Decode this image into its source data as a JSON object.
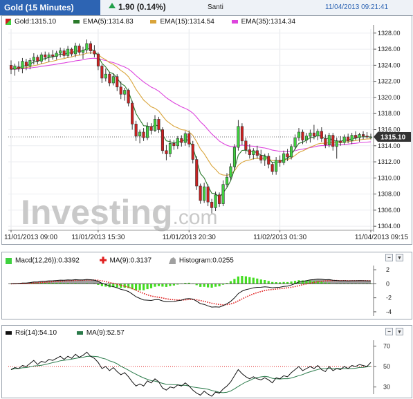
{
  "header": {
    "title": "Gold (15 Minutes)",
    "change": "1.90 (0.14%)",
    "user": "Santi",
    "datetime": "11/04/2013 09:21:41"
  },
  "price_panel": {
    "legend": {
      "instrument": "Gold:1315.10",
      "ema5": "EMA(5):1314.83",
      "ema15": "EMA(15):1314.54",
      "ema35": "EMA(35):1314.34"
    },
    "last_price_label": "1315.10",
    "watermark": "Investing.com"
  },
  "macd_panel": {
    "legend": {
      "macd": "Macd(12,26)):0.3392",
      "ma": "MA(9):0.3137",
      "hist": "Histogram:0.0255"
    }
  },
  "rsi_panel": {
    "legend": {
      "rsi": "Rsi(14):54.10",
      "ma": "MA(9):52.57"
    }
  },
  "colors": {
    "up": "#3fd23f",
    "down": "#cc2020",
    "ema5": "#2a7a2a",
    "ema15": "#d9a43a",
    "ema35": "#dd44dd",
    "brand": "#2d64b3",
    "macd_line": "#111111",
    "macd_signal": "#e02020",
    "macd_hist": "#44dd22",
    "hist_area": "#a0a0a0"
  },
  "chart_data": [
    {
      "type": "candlestick",
      "title": "Gold (15 Minutes)",
      "xlabel": "",
      "ylabel": "",
      "ylim": [
        1303.5,
        1328.5
      ],
      "yticks": [
        1304,
        1306,
        1308,
        1310,
        1312,
        1314,
        1316,
        1318,
        1320,
        1322,
        1324,
        1326,
        1328
      ],
      "x_tick_labels": [
        "11/01/2013 09:00",
        "11/01/2013 15:30",
        "11/01/2013 20:30",
        "11/02/2013 01:30",
        "11/04/2013 09:15"
      ],
      "x_tick_index": [
        0,
        23,
        47,
        71,
        95
      ],
      "last_price": 1315.1,
      "candles": [
        [
          1324.0,
          1324.6,
          1322.9,
          1323.5
        ],
        [
          1323.5,
          1324.2,
          1322.7,
          1323.9
        ],
        [
          1323.8,
          1324.5,
          1323.2,
          1323.6
        ],
        [
          1323.6,
          1324.9,
          1323.0,
          1324.5
        ],
        [
          1324.4,
          1324.8,
          1323.4,
          1323.9
        ],
        [
          1323.9,
          1324.9,
          1323.5,
          1324.6
        ],
        [
          1324.6,
          1325.5,
          1324.1,
          1325.0
        ],
        [
          1325.0,
          1325.3,
          1324.1,
          1324.5
        ],
        [
          1324.5,
          1325.6,
          1324.2,
          1325.3
        ],
        [
          1325.3,
          1325.7,
          1324.6,
          1325.0
        ],
        [
          1325.0,
          1325.6,
          1324.4,
          1325.3
        ],
        [
          1325.3,
          1325.9,
          1324.7,
          1325.1
        ],
        [
          1325.1,
          1325.8,
          1324.7,
          1325.5
        ],
        [
          1325.5,
          1326.2,
          1325.0,
          1325.8
        ],
        [
          1325.8,
          1326.1,
          1324.9,
          1325.2
        ],
        [
          1325.2,
          1326.4,
          1324.9,
          1326.0
        ],
        [
          1326.0,
          1326.2,
          1325.1,
          1325.4
        ],
        [
          1325.4,
          1326.8,
          1325.0,
          1326.4
        ],
        [
          1326.4,
          1326.7,
          1325.3,
          1325.6
        ],
        [
          1325.6,
          1326.3,
          1324.8,
          1325.9
        ],
        [
          1325.9,
          1327.2,
          1325.5,
          1326.7
        ],
        [
          1326.7,
          1327.0,
          1325.4,
          1325.8
        ],
        [
          1325.8,
          1326.5,
          1325.0,
          1325.4
        ],
        [
          1325.4,
          1325.6,
          1323.4,
          1323.9
        ],
        [
          1323.9,
          1324.1,
          1321.8,
          1322.4
        ],
        [
          1322.4,
          1323.6,
          1322.0,
          1322.9
        ],
        [
          1322.9,
          1323.2,
          1321.4,
          1321.8
        ],
        [
          1321.8,
          1323.0,
          1321.5,
          1322.6
        ],
        [
          1322.6,
          1322.9,
          1320.8,
          1321.3
        ],
        [
          1321.3,
          1322.0,
          1319.8,
          1320.4
        ],
        [
          1320.4,
          1321.2,
          1319.6,
          1320.9
        ],
        [
          1320.9,
          1321.1,
          1318.9,
          1319.3
        ],
        [
          1319.3,
          1319.6,
          1316.0,
          1316.7
        ],
        [
          1316.7,
          1317.1,
          1314.6,
          1315.2
        ],
        [
          1315.2,
          1316.0,
          1314.3,
          1315.7
        ],
        [
          1315.7,
          1316.2,
          1314.6,
          1315.0
        ],
        [
          1315.0,
          1316.9,
          1314.7,
          1316.4
        ],
        [
          1316.4,
          1316.8,
          1315.4,
          1315.9
        ],
        [
          1315.9,
          1317.8,
          1315.7,
          1317.3
        ],
        [
          1317.3,
          1317.6,
          1315.6,
          1316.0
        ],
        [
          1316.0,
          1316.3,
          1313.0,
          1313.4
        ],
        [
          1313.4,
          1314.1,
          1312.2,
          1313.0
        ],
        [
          1313.0,
          1314.8,
          1312.6,
          1314.3
        ],
        [
          1314.3,
          1314.7,
          1313.5,
          1314.0
        ],
        [
          1314.0,
          1315.2,
          1313.6,
          1314.9
        ],
        [
          1314.9,
          1315.3,
          1313.9,
          1314.4
        ],
        [
          1314.4,
          1315.8,
          1314.0,
          1315.5
        ],
        [
          1315.5,
          1315.9,
          1313.8,
          1314.2
        ],
        [
          1314.2,
          1314.6,
          1311.8,
          1312.3
        ],
        [
          1312.3,
          1312.7,
          1308.5,
          1309.0
        ],
        [
          1309.0,
          1309.3,
          1306.8,
          1307.2
        ],
        [
          1307.2,
          1309.4,
          1306.9,
          1308.9
        ],
        [
          1308.9,
          1309.2,
          1306.5,
          1307.0
        ],
        [
          1307.0,
          1307.4,
          1305.6,
          1306.3
        ],
        [
          1306.3,
          1308.3,
          1305.9,
          1307.9
        ],
        [
          1307.9,
          1308.2,
          1306.4,
          1306.8
        ],
        [
          1306.8,
          1309.7,
          1306.5,
          1309.2
        ],
        [
          1309.2,
          1310.6,
          1308.9,
          1310.1
        ],
        [
          1310.1,
          1311.8,
          1309.7,
          1311.4
        ],
        [
          1311.4,
          1314.2,
          1311.0,
          1313.8
        ],
        [
          1313.8,
          1317.2,
          1313.4,
          1316.4
        ],
        [
          1316.4,
          1316.8,
          1314.1,
          1314.6
        ],
        [
          1314.6,
          1315.0,
          1313.0,
          1313.5
        ],
        [
          1313.5,
          1314.2,
          1312.4,
          1312.9
        ],
        [
          1312.9,
          1313.7,
          1312.3,
          1313.4
        ],
        [
          1313.4,
          1314.0,
          1312.4,
          1312.8
        ],
        [
          1312.8,
          1313.5,
          1311.8,
          1312.2
        ],
        [
          1312.2,
          1313.0,
          1311.5,
          1312.7
        ],
        [
          1312.7,
          1313.1,
          1311.2,
          1311.7
        ],
        [
          1311.7,
          1312.0,
          1310.4,
          1310.8
        ],
        [
          1310.8,
          1312.6,
          1310.4,
          1312.2
        ],
        [
          1312.2,
          1312.8,
          1311.4,
          1311.9
        ],
        [
          1311.9,
          1313.4,
          1311.6,
          1313.0
        ],
        [
          1313.0,
          1313.6,
          1312.1,
          1312.6
        ],
        [
          1312.6,
          1314.2,
          1312.3,
          1313.9
        ],
        [
          1313.9,
          1315.4,
          1313.5,
          1315.0
        ],
        [
          1315.0,
          1316.2,
          1314.6,
          1315.7
        ],
        [
          1315.7,
          1316.0,
          1314.2,
          1314.7
        ],
        [
          1314.7,
          1315.6,
          1314.3,
          1315.2
        ],
        [
          1315.2,
          1316.0,
          1314.4,
          1315.6
        ],
        [
          1315.6,
          1316.6,
          1314.8,
          1315.2
        ],
        [
          1315.2,
          1316.1,
          1314.7,
          1315.8
        ],
        [
          1315.8,
          1316.3,
          1314.5,
          1314.9
        ],
        [
          1314.9,
          1315.4,
          1313.7,
          1314.1
        ],
        [
          1314.1,
          1315.6,
          1313.8,
          1315.3
        ],
        [
          1315.3,
          1315.6,
          1313.4,
          1313.9
        ],
        [
          1313.9,
          1315.0,
          1312.4,
          1314.6
        ],
        [
          1314.6,
          1315.2,
          1314.0,
          1314.4
        ],
        [
          1314.4,
          1315.4,
          1314.1,
          1315.1
        ],
        [
          1315.1,
          1315.5,
          1314.3,
          1314.6
        ],
        [
          1314.6,
          1315.6,
          1314.2,
          1315.3
        ],
        [
          1315.3,
          1315.8,
          1314.7,
          1315.0
        ],
        [
          1315.0,
          1315.6,
          1314.5,
          1315.4
        ],
        [
          1315.4,
          1315.8,
          1314.8,
          1315.2
        ],
        [
          1315.2,
          1315.7,
          1314.9,
          1315.1
        ],
        [
          1315.1,
          1315.5,
          1314.8,
          1315.1
        ]
      ],
      "ema5_last": 1314.83,
      "ema15_last": 1314.54,
      "ema35_last": 1314.34
    },
    {
      "type": "macd",
      "ylim": [
        -4.6,
        2.6
      ],
      "yticks": [
        2,
        0,
        -2,
        -4
      ],
      "macd_last": 0.3392,
      "signal_last": 0.3137,
      "histogram_last": 0.0255
    },
    {
      "type": "line",
      "ylim": [
        23,
        73
      ],
      "yticks": [
        70,
        50,
        30
      ],
      "reference_line": 50,
      "rsi": [
        47,
        49,
        48,
        51,
        50,
        53,
        56,
        52,
        55,
        54,
        57,
        56,
        58,
        60,
        57,
        60,
        58,
        62,
        59,
        61,
        64,
        60,
        58,
        54,
        48,
        50,
        46,
        49,
        45,
        42,
        44,
        40,
        35,
        31,
        33,
        31,
        36,
        34,
        38,
        35,
        29,
        27,
        30,
        29,
        32,
        31,
        34,
        31,
        27,
        24,
        22,
        26,
        23,
        21,
        25,
        24,
        28,
        31,
        35,
        41,
        47,
        43,
        40,
        38,
        40,
        38,
        37,
        39,
        37,
        34,
        39,
        38,
        41,
        40,
        44,
        47,
        50,
        46,
        48,
        50,
        48,
        51,
        47,
        45,
        50,
        46,
        48,
        47,
        50,
        48,
        51,
        50,
        52,
        51,
        50,
        54
      ],
      "rsi_last": 54.1,
      "ma_last": 52.57
    }
  ]
}
